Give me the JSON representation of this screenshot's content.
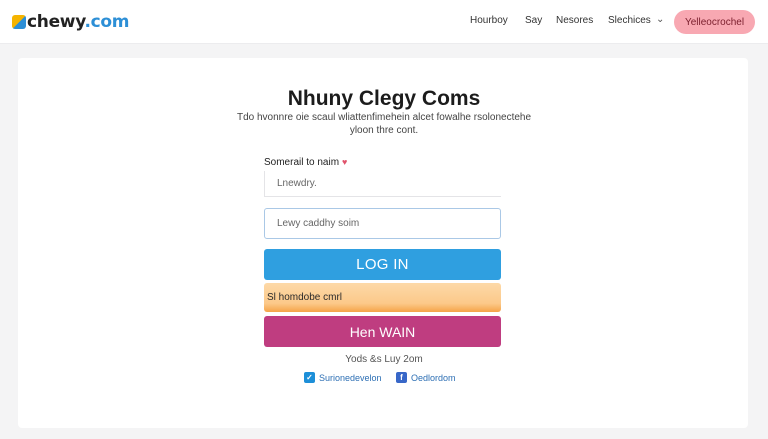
{
  "header": {
    "logo": {
      "brand": "chewy",
      "suffix": ".com"
    },
    "nav": [
      "Hourboy",
      "Say",
      "Nesores",
      "Slechices"
    ],
    "cta_label": "Yelleocrochel"
  },
  "login": {
    "title": "Nhuny Clegy Coms",
    "subtitle": "Tdo hvonnre oie scaul wliattenfimehein alcet fowalhe rsolonectehe yloon thre cont.",
    "field_label": "Somerail to naim",
    "field1_placeholder": "Lnewdry.",
    "field2_placeholder": "Lewy caddhy soim",
    "login_label": "LOG IN",
    "secondary_label": "Sl homdobe cmrl",
    "signup_label": "Hen WAIN"
  },
  "footer": {
    "note": "Yods &s Luy 2om",
    "social1_label": "Surionedevelon",
    "social2_label": "Oedlordom"
  },
  "colors": {
    "accent": "#2f9fe0",
    "signup": "#bf3d80",
    "cta": "#f8a8b2",
    "orange": "#fcc98a"
  },
  "icons": {
    "logo": "chewy-logo-icon",
    "nav_dropdown": "chevron-down-icon",
    "required": "heart-icon",
    "social1": "checkbox-icon",
    "social2": "facebook-icon"
  }
}
